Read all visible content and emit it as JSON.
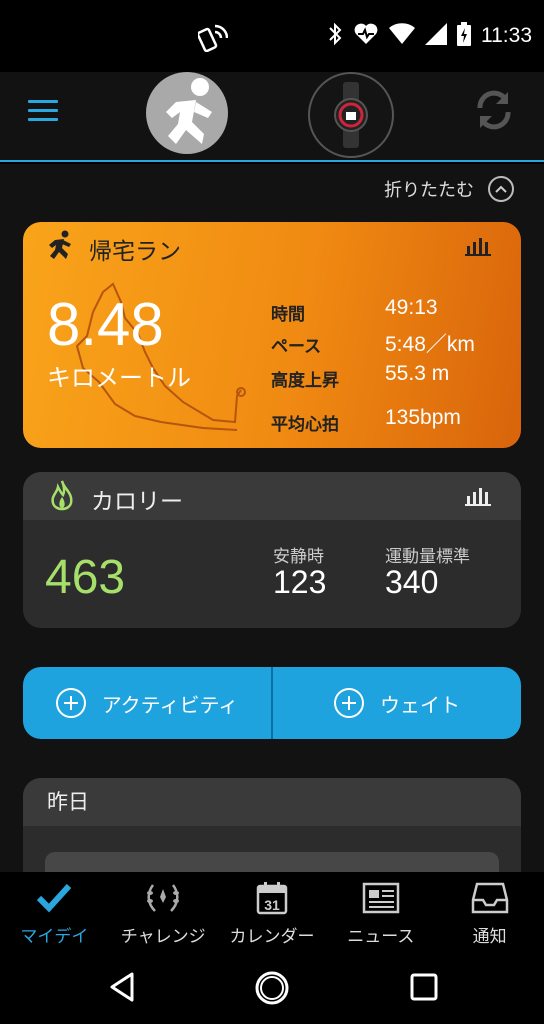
{
  "status_bar": {
    "time": "11:33",
    "icons": [
      "nfc-icon",
      "bluetooth-icon",
      "heart-monitor-icon",
      "wifi-icon",
      "signal-icon",
      "battery-icon"
    ]
  },
  "header": {
    "icons": [
      "menu-icon",
      "running-person-icon",
      "watch-icon",
      "sync-icon"
    ]
  },
  "collapse": {
    "label": "折りたたむ"
  },
  "activity": {
    "title": "帰宅ラン",
    "distance": "8.48",
    "unit": "キロメートル",
    "stats": [
      {
        "label": "時間",
        "value": "49:13"
      },
      {
        "label": "ペース",
        "value": "5:48／km"
      },
      {
        "label": "高度上昇",
        "value": "55.3 m"
      },
      {
        "label": "平均心拍",
        "value": "135bpm"
      }
    ],
    "color": "#f39a16"
  },
  "calories": {
    "title": "カロリー",
    "total": "463",
    "resting_label": "安静時",
    "resting_value": "123",
    "active_label": "運動量標準",
    "active_value": "340",
    "total_color": "#a6e06a"
  },
  "actions": {
    "activity_label": "アクティビティ",
    "weight_label": "ウェイト",
    "color": "#1fa3df"
  },
  "yesterday": {
    "title": "昨日"
  },
  "bottom_nav": {
    "items": [
      {
        "label": "マイデイ",
        "icon": "checkmark-icon",
        "active": true
      },
      {
        "label": "チャレンジ",
        "icon": "laurel-icon",
        "active": false
      },
      {
        "label": "カレンダー",
        "icon": "calendar-icon",
        "day": "31",
        "active": false
      },
      {
        "label": "ニュース",
        "icon": "newspaper-icon",
        "active": false
      },
      {
        "label": "通知",
        "icon": "inbox-icon",
        "active": false
      }
    ]
  },
  "accent_color": "#2aa7df"
}
